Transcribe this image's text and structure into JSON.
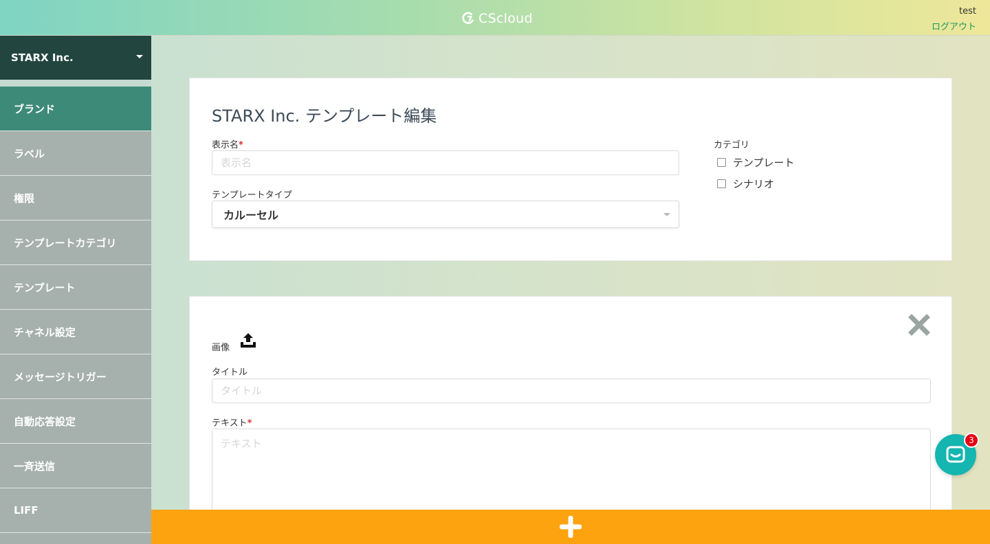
{
  "header": {
    "logo_text": "CScloud",
    "user_name": "test",
    "logout_label": "ログアウト"
  },
  "sidebar": {
    "org_name": "STARX Inc.",
    "items": [
      {
        "label": "ブランド",
        "active": true
      },
      {
        "label": "ラベル"
      },
      {
        "label": "権限"
      },
      {
        "label": "テンプレートカテゴリ"
      },
      {
        "label": "テンプレート"
      },
      {
        "label": "チャネル設定"
      },
      {
        "label": "メッセージトリガー"
      },
      {
        "label": "自動応答設定"
      },
      {
        "label": "一斉送信"
      },
      {
        "label": "LIFF"
      }
    ]
  },
  "template_card": {
    "title": "STARX Inc. テンプレート編集",
    "display_name": {
      "label": "表示名",
      "required_mark": "*",
      "placeholder": "表示名",
      "value": ""
    },
    "template_type": {
      "label": "テンプレートタイプ",
      "selected": "カルーセル"
    },
    "category": {
      "label": "カテゴリ",
      "options": [
        {
          "label": "テンプレート",
          "checked": false
        },
        {
          "label": "シナリオ",
          "checked": false
        }
      ]
    }
  },
  "carousel_item": {
    "image_label": "画像",
    "title_field": {
      "label": "タイトル",
      "placeholder": "タイトル",
      "value": ""
    },
    "text_field": {
      "label": "テキスト",
      "required_mark": "*",
      "placeholder": "テキスト",
      "value": ""
    }
  },
  "chat_widget": {
    "badge_count": "3"
  },
  "colors": {
    "sidebar_active": "#3d8a78",
    "sidebar_org": "#22463f",
    "add_bar": "#fca30f",
    "chat": "#15b5b0",
    "logout_link": "#1a9a5b"
  }
}
